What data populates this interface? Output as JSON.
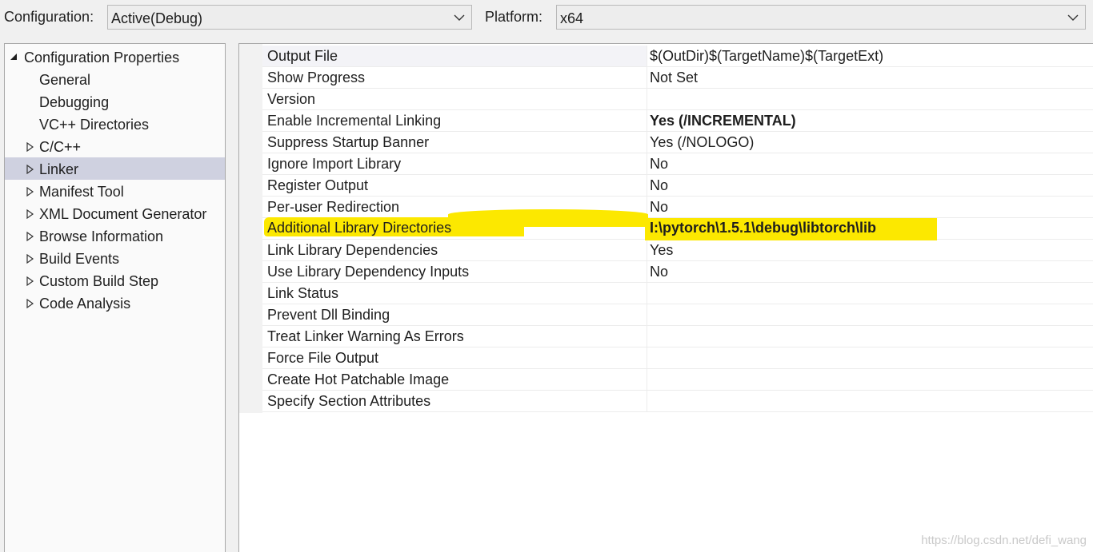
{
  "topbar": {
    "configuration_label": "Configuration:",
    "configuration_value": "Active(Debug)",
    "platform_label": "Platform:",
    "platform_value": "x64"
  },
  "tree": {
    "root": "Configuration Properties",
    "items": [
      {
        "label": "General",
        "expandable": false
      },
      {
        "label": "Debugging",
        "expandable": false
      },
      {
        "label": "VC++ Directories",
        "expandable": false
      },
      {
        "label": "C/C++",
        "expandable": true
      },
      {
        "label": "Linker",
        "expandable": true,
        "selected": true
      },
      {
        "label": "Manifest Tool",
        "expandable": true
      },
      {
        "label": "XML Document Generator",
        "expandable": true
      },
      {
        "label": "Browse Information",
        "expandable": true
      },
      {
        "label": "Build Events",
        "expandable": true
      },
      {
        "label": "Custom Build Step",
        "expandable": true
      },
      {
        "label": "Code Analysis",
        "expandable": true
      }
    ]
  },
  "properties": [
    {
      "name": "Output File",
      "value": "$(OutDir)$(TargetName)$(TargetExt)",
      "bold": false
    },
    {
      "name": "Show Progress",
      "value": "Not Set",
      "bold": false
    },
    {
      "name": "Version",
      "value": "",
      "bold": false
    },
    {
      "name": "Enable Incremental Linking",
      "value": "Yes (/INCREMENTAL)",
      "bold": true
    },
    {
      "name": "Suppress Startup Banner",
      "value": "Yes (/NOLOGO)",
      "bold": false
    },
    {
      "name": "Ignore Import Library",
      "value": "No",
      "bold": false
    },
    {
      "name": "Register Output",
      "value": "No",
      "bold": false
    },
    {
      "name": "Per-user Redirection",
      "value": "No",
      "bold": false
    },
    {
      "name": "Additional Library Directories",
      "value": "I:\\pytorch\\1.5.1\\debug\\libtorch\\lib",
      "bold": true,
      "highlighted": true
    },
    {
      "name": "Link Library Dependencies",
      "value": "Yes",
      "bold": false
    },
    {
      "name": "Use Library Dependency Inputs",
      "value": "No",
      "bold": false
    },
    {
      "name": "Link Status",
      "value": "",
      "bold": false
    },
    {
      "name": "Prevent Dll Binding",
      "value": "",
      "bold": false
    },
    {
      "name": "Treat Linker Warning As Errors",
      "value": "",
      "bold": false
    },
    {
      "name": "Force File Output",
      "value": "",
      "bold": false
    },
    {
      "name": "Create Hot Patchable Image",
      "value": "",
      "bold": false
    },
    {
      "name": "Specify Section Attributes",
      "value": "",
      "bold": false
    }
  ],
  "colors": {
    "selection": "#cfd1e0",
    "highlight_marker": "#fce800"
  },
  "icons": {
    "expanded": "triangle-down-icon",
    "collapsed": "triangle-right-icon",
    "dropdown": "chevron-down-icon"
  },
  "watermark": "https://blog.csdn.net/defi_wang"
}
